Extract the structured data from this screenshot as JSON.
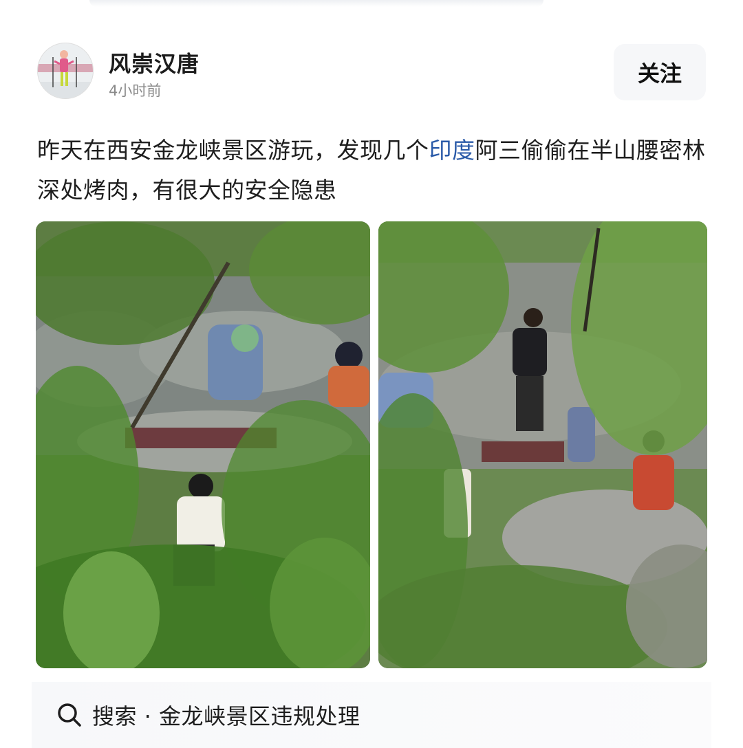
{
  "post": {
    "author": {
      "name": "风崇汉唐",
      "time": "4小时前"
    },
    "follow_label": "关注",
    "text_before_link": "昨天在西安金龙峡景区游玩，发现几个",
    "link_text": "印度",
    "text_after_link": "阿三偷偷在半山腰密林深处烤肉，有很大的安全隐患",
    "images": [
      "photo-left",
      "photo-right"
    ]
  },
  "search": {
    "icon": "search-icon",
    "label": "搜索 · 金龙峡景区违规处理"
  },
  "colors": {
    "link": "#2a5aa8",
    "text": "#1e1e1e",
    "muted": "#8a8a8a",
    "button_bg": "#f6f7f9"
  }
}
